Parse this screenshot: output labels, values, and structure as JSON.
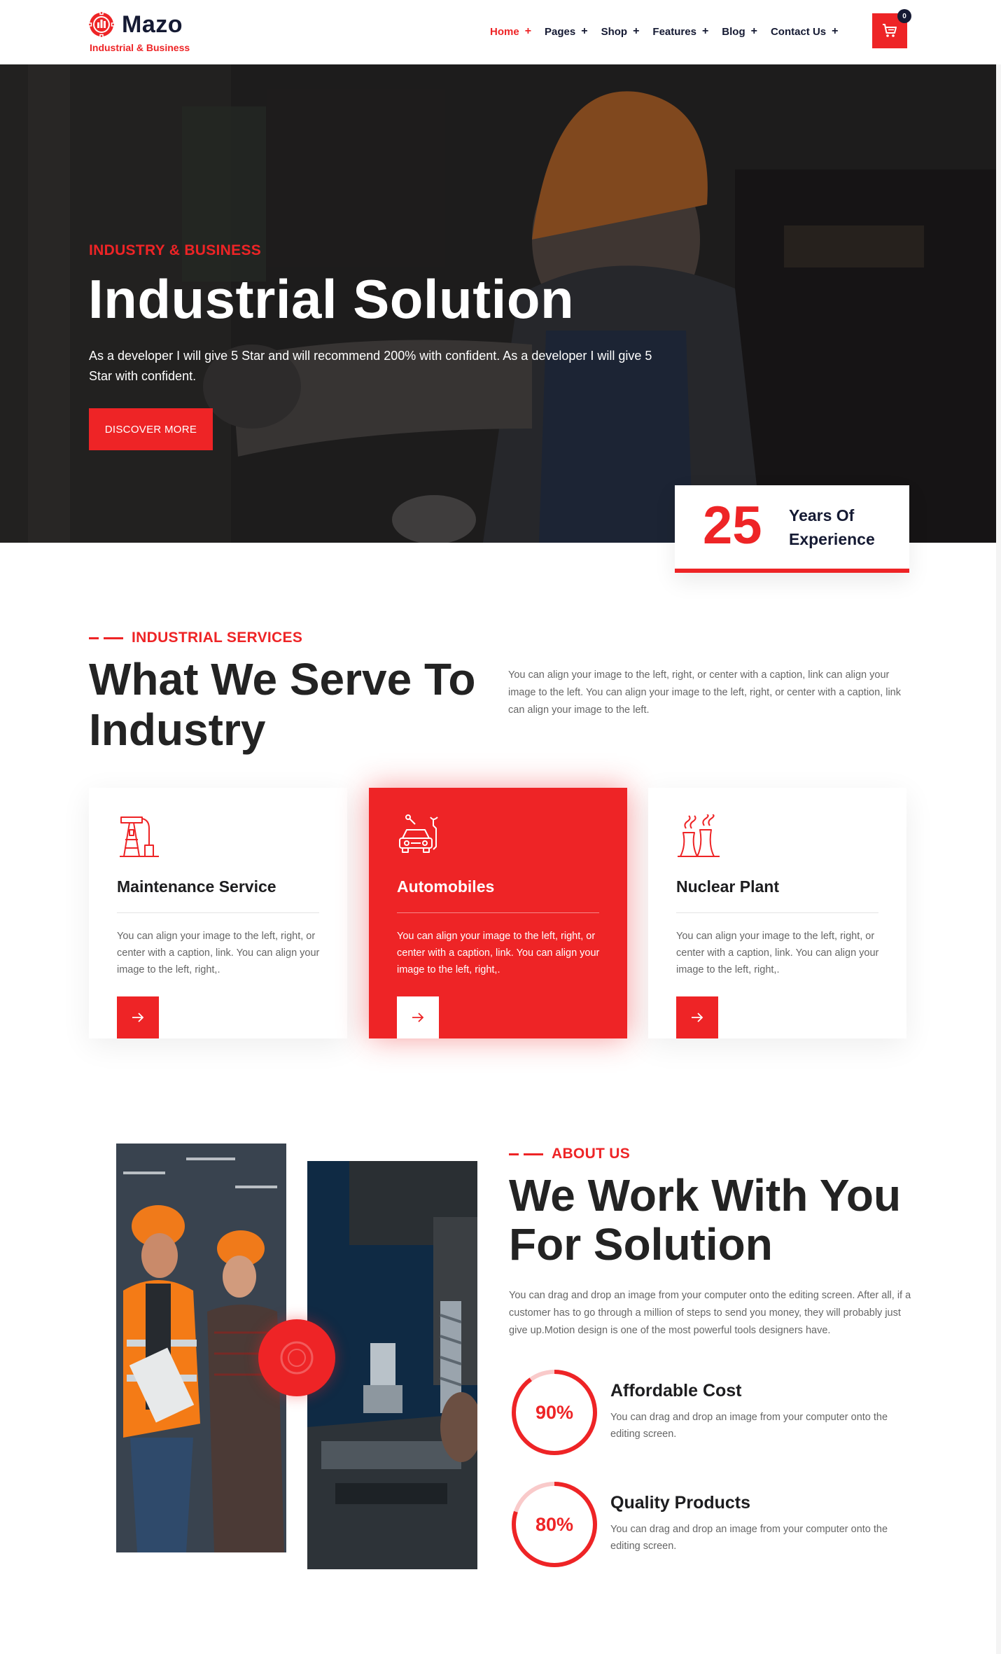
{
  "brand": {
    "name": "Mazo",
    "tagline": "Industrial & Business",
    "accent_color": "#ee2426",
    "dark_color": "#151a33"
  },
  "nav": {
    "items": [
      {
        "label": "Home",
        "active": true
      },
      {
        "label": "Pages",
        "active": false
      },
      {
        "label": "Shop",
        "active": false
      },
      {
        "label": "Features",
        "active": false
      },
      {
        "label": "Blog",
        "active": false
      },
      {
        "label": "Contact Us",
        "active": false
      }
    ],
    "plus": "+",
    "cart_count": "0",
    "cart_icon": "shopping-cart-icon"
  },
  "hero": {
    "kicker": "INDUSTRY & BUSINESS",
    "title": "Industrial Solution",
    "description": "As a developer I will give 5 Star and will recommend 200% with confident. As a developer I will give 5 Star with confident.",
    "button_label": "DISCOVER MORE",
    "experience_number": "25",
    "experience_text": "Years Of Experience"
  },
  "services": {
    "kicker": "INDUSTRIAL SERVICES",
    "title": "What We Serve To Industry",
    "description": "You can align your image to the left, right, or center with a caption, link can align your image to the left. You can align your image to the left, right, or center with a caption, link can align your image to the left.",
    "cards": [
      {
        "title": "Maintenance Service",
        "text": "You can align your image to the left, right, or center with a caption, link. You can align your image to the left, right,.",
        "icon": "oil-pump-icon"
      },
      {
        "title": "Automobiles",
        "text": "You can align your image to the left, right, or center with a caption, link. You can align your image to the left, right,.",
        "icon": "car-repair-icon"
      },
      {
        "title": "Nuclear Plant",
        "text": "You can align your image to the left, right, or center with a caption, link. You can align your image to the left, right,.",
        "icon": "cooling-tower-icon"
      }
    ],
    "arrow_icon": "arrow-right-icon"
  },
  "about": {
    "kicker": "ABOUT US",
    "title": "We Work With You For Solution",
    "description": "You can drag and drop an image from your computer onto the editing screen. After all, if a customer has to go through a million of steps to send you money, they will probably just give up.Motion design is one of the most powerful tools designers have.",
    "features": [
      {
        "percent_label": "90%",
        "percent": 90,
        "title": "Affordable Cost",
        "text": "You can drag and drop an image from your computer onto the editing screen."
      },
      {
        "percent_label": "80%",
        "percent": 80,
        "title": "Quality Products",
        "text": "You can drag and drop an image from your computer onto the editing screen."
      }
    ]
  }
}
